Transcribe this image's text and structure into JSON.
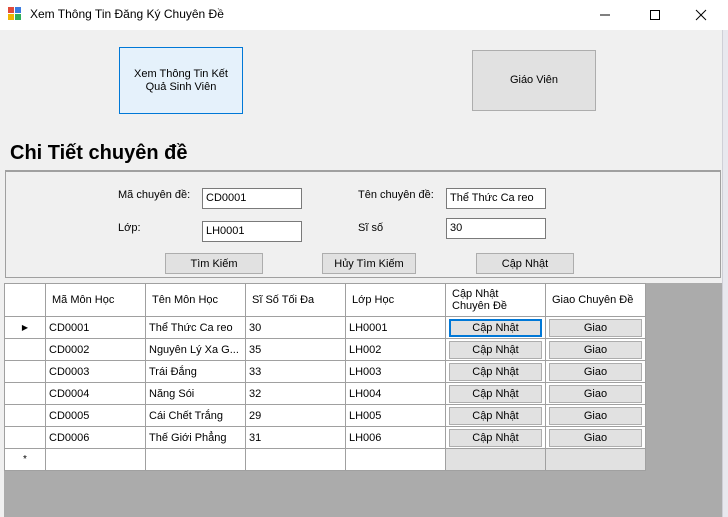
{
  "window": {
    "title": "Xem Thông Tin Đăng Ký Chuyên Đề"
  },
  "buttons": {
    "xem_ket_qua_line1": "Xem Thông Tin Kết",
    "xem_ket_qua_line2": "Quả Sinh Viên",
    "giao_vien": "Giáo Viên"
  },
  "heading": "Chi Tiết chuyên đề",
  "form": {
    "ma_label": "Mã chuyên đề:",
    "ma_value": "CD0001",
    "ten_label": "Tên chuyên đề:",
    "ten_value": "Thể Thức Ca reo",
    "lop_label": "Lớp:",
    "lop_value": "LH0001",
    "siso_label": "Sĩ số",
    "siso_value": "30",
    "tim_kiem": "Tìm Kiếm",
    "huy_tim_kiem": "Hủy Tìm Kiếm",
    "cap_nhat": "Cập Nhật"
  },
  "grid": {
    "columns": [
      "Mã Môn Học",
      "Tên Môn Học",
      "Sĩ Số Tối Đa",
      "Lớp Học",
      "Cập Nhật Chuyên Đề",
      "Giao Chuyên Đề"
    ],
    "rows": [
      {
        "ma": "CD0001",
        "ten": "Thể Thức Ca reo",
        "siso": "30",
        "lop": "LH0001",
        "capnhat": "Cập Nhật",
        "giao": "Giao"
      },
      {
        "ma": "CD0002",
        "ten": "Nguyên  Lý Xa G...",
        "siso": "35",
        "lop": "LH002",
        "capnhat": "Cập Nhật",
        "giao": "Giao"
      },
      {
        "ma": "CD0003",
        "ten": "Trái Đắng",
        "siso": "33",
        "lop": "LH003",
        "capnhat": "Cập Nhật",
        "giao": "Giao"
      },
      {
        "ma": "CD0004",
        "ten": "Năng Sói",
        "siso": "32",
        "lop": "LH004",
        "capnhat": "Cập Nhật",
        "giao": "Giao"
      },
      {
        "ma": "CD0005",
        "ten": "Cái Chết Trắng",
        "siso": "29",
        "lop": "LH005",
        "capnhat": "Cập Nhật",
        "giao": "Giao"
      },
      {
        "ma": "CD0006",
        "ten": "Thế Giới Phẳng",
        "siso": "31",
        "lop": "LH006",
        "capnhat": "Cập Nhật",
        "giao": "Giao"
      }
    ],
    "current_row_marker": "▶",
    "new_row_marker": "*"
  }
}
